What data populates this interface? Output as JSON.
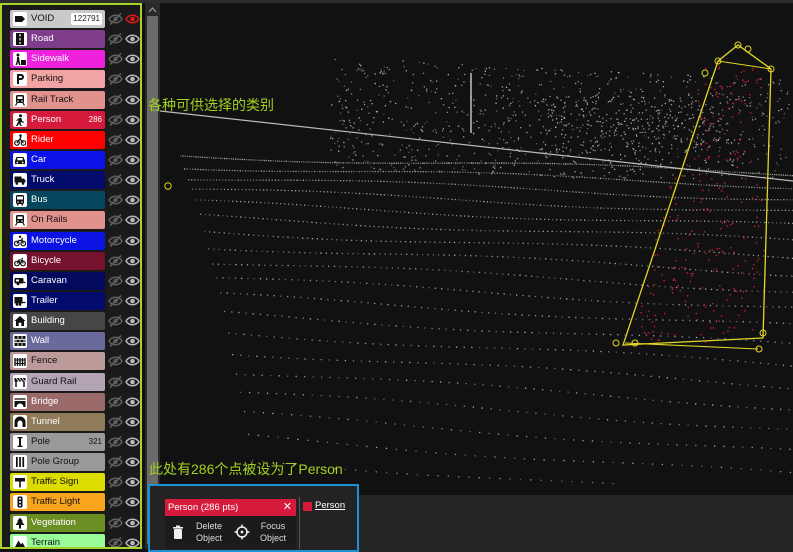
{
  "categories": [
    {
      "name": "VOID",
      "count": "122791",
      "color": "#c9c9c9",
      "icon": "tag-icon",
      "dark": true,
      "eye_active": true
    },
    {
      "name": "Road",
      "count": "",
      "color": "#7d3d8a",
      "icon": "road-icon"
    },
    {
      "name": "Sidewalk",
      "count": "",
      "color": "#ee22dd",
      "icon": "pedestrian-icon"
    },
    {
      "name": "Parking",
      "count": "",
      "color": "#f2a4a4",
      "icon": "parking-icon",
      "dark": true
    },
    {
      "name": "Rail Track",
      "count": "",
      "color": "#e2928c",
      "icon": "train-icon",
      "dark": true
    },
    {
      "name": "Person",
      "count": "286",
      "color": "#d61a3c",
      "icon": "person-walking-icon"
    },
    {
      "name": "Rider",
      "count": "",
      "color": "#ff0000",
      "icon": "bicycle-rider-icon"
    },
    {
      "name": "Car",
      "count": "",
      "color": "#0b12e6",
      "icon": "car-icon"
    },
    {
      "name": "Truck",
      "count": "",
      "color": "#020a6c",
      "icon": "truck-icon"
    },
    {
      "name": "Bus",
      "count": "",
      "color": "#05465e",
      "icon": "bus-icon"
    },
    {
      "name": "On Rails",
      "count": "",
      "color": "#e2928c",
      "icon": "tram-icon",
      "dark": true
    },
    {
      "name": "Motorcycle",
      "count": "",
      "color": "#0a13e1",
      "icon": "motorcycle-icon"
    },
    {
      "name": "Bicycle",
      "count": "",
      "color": "#76112e",
      "icon": "bicycle-icon"
    },
    {
      "name": "Caravan",
      "count": "",
      "color": "#030a5d",
      "icon": "caravan-icon"
    },
    {
      "name": "Trailer",
      "count": "",
      "color": "#020a6c",
      "icon": "trailer-icon"
    },
    {
      "name": "Building",
      "count": "",
      "color": "#464646",
      "icon": "house-icon"
    },
    {
      "name": "Wall",
      "count": "",
      "color": "#6a6a9c",
      "icon": "wall-icon"
    },
    {
      "name": "Fence",
      "count": "",
      "color": "#bc9a9a",
      "icon": "fence-icon",
      "dark": true
    },
    {
      "name": "Guard Rail",
      "count": "",
      "color": "#b3a4b4",
      "icon": "guard-rail-icon",
      "dark": true
    },
    {
      "name": "Bridge",
      "count": "",
      "color": "#9a6a6a",
      "icon": "bridge-icon"
    },
    {
      "name": "Tunnel",
      "count": "",
      "color": "#8f7a5a",
      "icon": "tunnel-icon"
    },
    {
      "name": "Pole",
      "count": "321",
      "color": "#999999",
      "icon": "pole-icon",
      "dark": true
    },
    {
      "name": "Pole Group",
      "count": "",
      "color": "#999999",
      "icon": "pole-group-icon",
      "dark": true
    },
    {
      "name": "Traffic Sign",
      "count": "",
      "color": "#dcdc00",
      "icon": "traffic-sign-icon",
      "dark": true
    },
    {
      "name": "Traffic Light",
      "count": "",
      "color": "#f8a41c",
      "icon": "traffic-light-icon",
      "dark": true
    },
    {
      "name": "Vegetation",
      "count": "",
      "color": "#6b8e23",
      "icon": "tree-icon"
    },
    {
      "name": "Terrain",
      "count": "",
      "color": "#98fb98",
      "icon": "terrain-icon",
      "dark": true
    }
  ],
  "annotations": {
    "categories_note": "各种可供选择的类别",
    "points_note": "此处有286个点被设为了Person"
  },
  "object_panel": {
    "title": "Person (286 pts)",
    "close": "✕",
    "delete_label": "Delete Object",
    "focus_label": "Focus Object",
    "legend_label": "Person",
    "legend_color": "#d61a3c"
  },
  "colors": {
    "annotation": "#a3d11f",
    "sidebar_border": "#a8d22a",
    "panel_border": "#1e90d5",
    "bbox": "#e3d724",
    "selected_points": "#d8213f",
    "ground_points": "#cfcfcf"
  }
}
